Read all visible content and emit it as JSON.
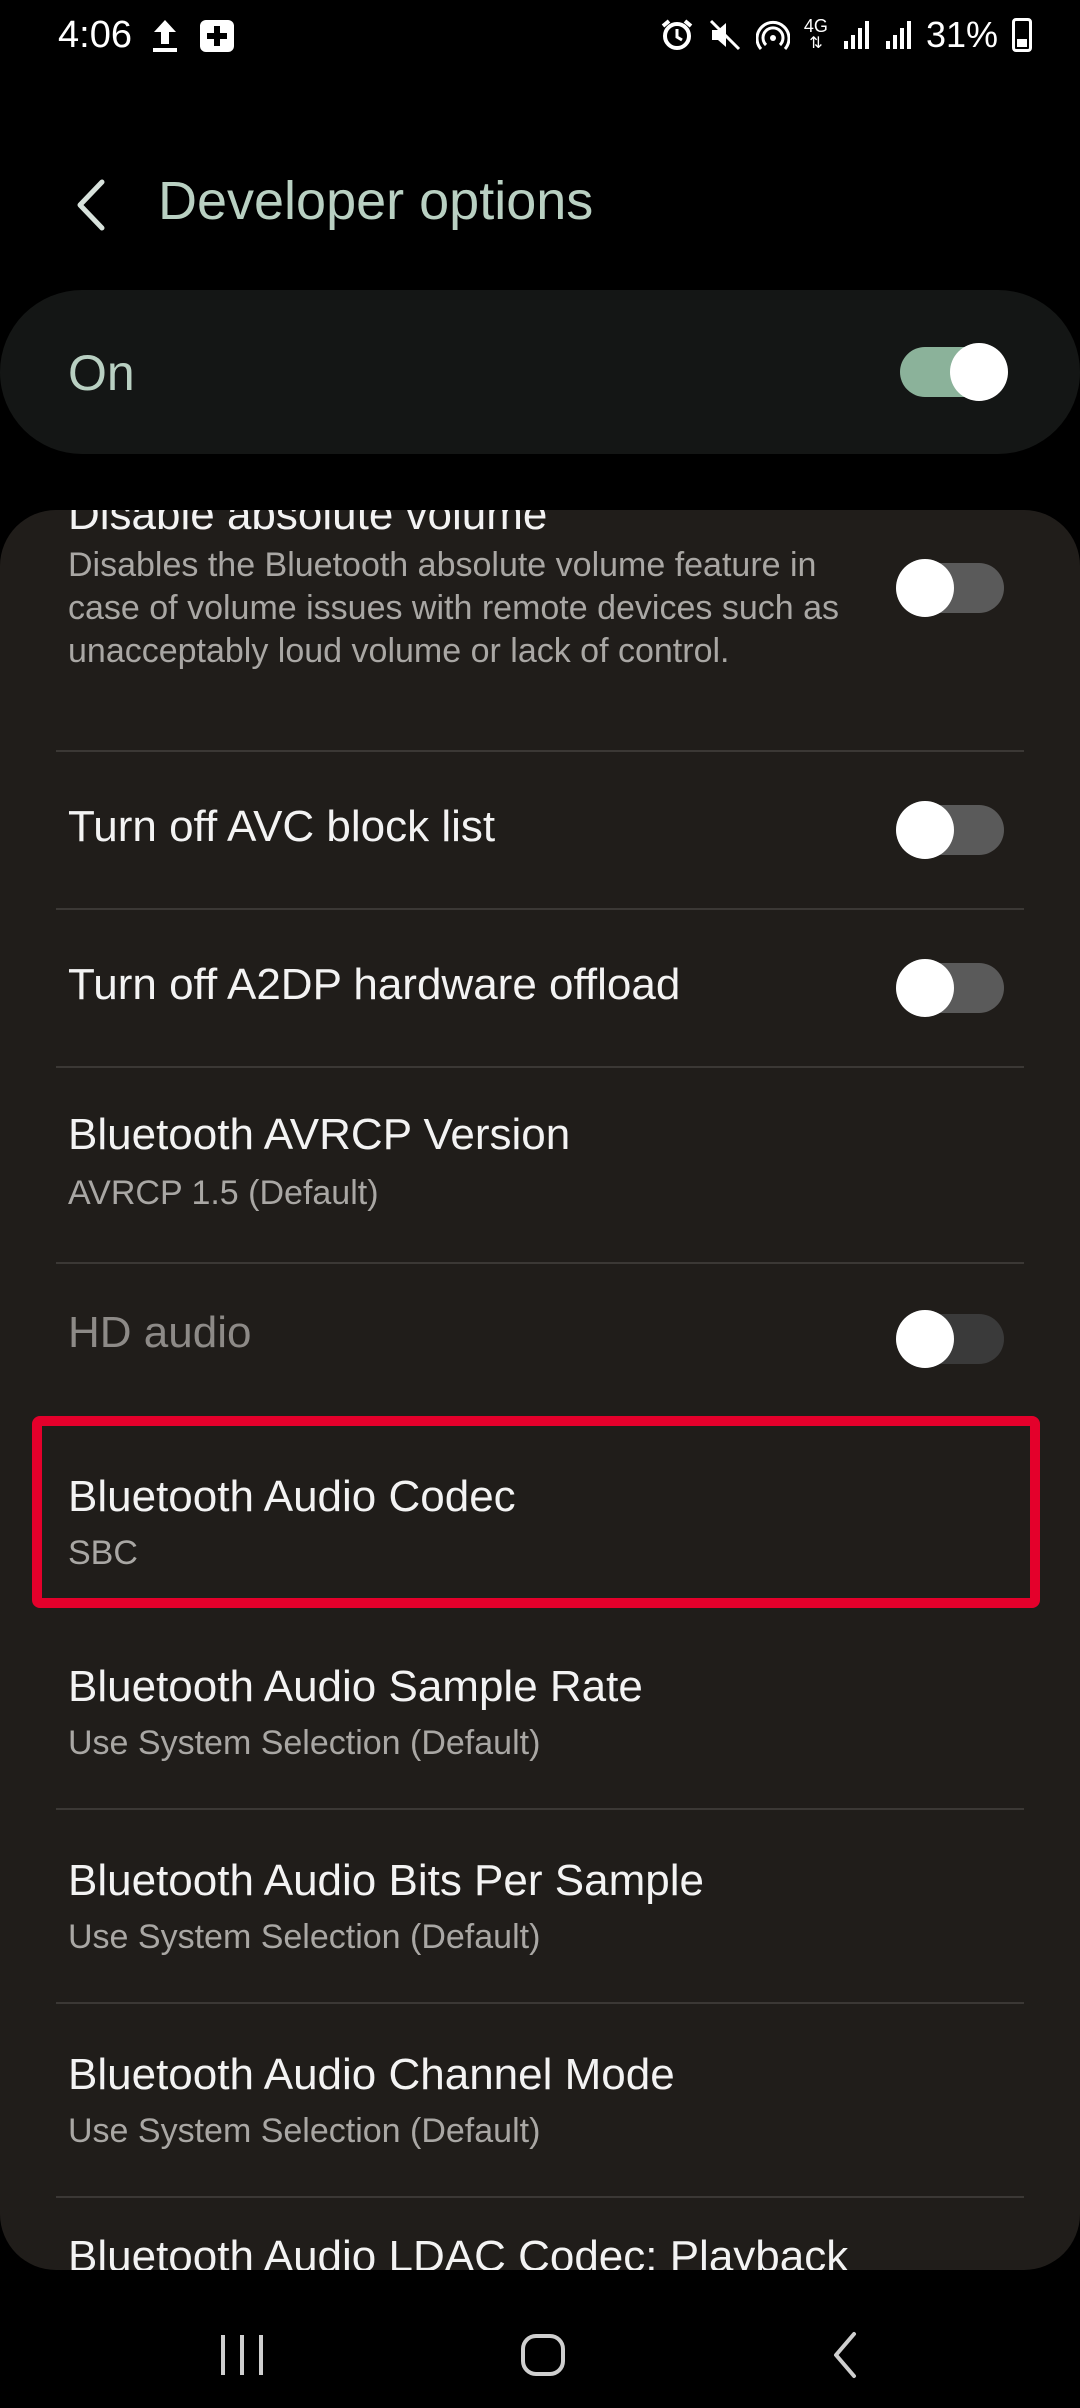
{
  "status_bar": {
    "time": "4:06",
    "network": "4G",
    "battery": "31%",
    "icons": [
      "upload-icon",
      "plus-box-icon",
      "alarm-icon",
      "mute-icon",
      "hotspot-icon",
      "network-4g-icon",
      "signal-icon",
      "signal-icon",
      "battery-icon"
    ]
  },
  "header": {
    "title": "Developer options"
  },
  "master": {
    "label": "On",
    "enabled": true
  },
  "settings": {
    "partial_top_title": "Disable absolute volume",
    "disable_absolute_volume_desc": "Disables the Bluetooth absolute volume feature in case of volume issues with remote devices such as unacceptably loud volume or lack of control.",
    "avc_title": "Turn off AVC block list",
    "a2dp_title": "Turn off A2DP hardware offload",
    "avrcp_title": "Bluetooth AVRCP Version",
    "avrcp_value": "AVRCP 1.5 (Default)",
    "hd_audio_title": "HD audio",
    "codec_title": "Bluetooth Audio Codec",
    "codec_value": "SBC",
    "sample_rate_title": "Bluetooth Audio Sample Rate",
    "sample_rate_value": "Use System Selection (Default)",
    "bits_title": "Bluetooth Audio Bits Per Sample",
    "bits_value": "Use System Selection (Default)",
    "channel_title": "Bluetooth Audio Channel Mode",
    "channel_value": "Use System Selection (Default)",
    "partial_bottom_title": "Bluetooth Audio LDAC Codec: Playback"
  },
  "colors": {
    "accent": "#8bb29a",
    "title_text": "#b9d0c2",
    "highlight": "#e4002b",
    "card_bg": "#201d1a"
  }
}
